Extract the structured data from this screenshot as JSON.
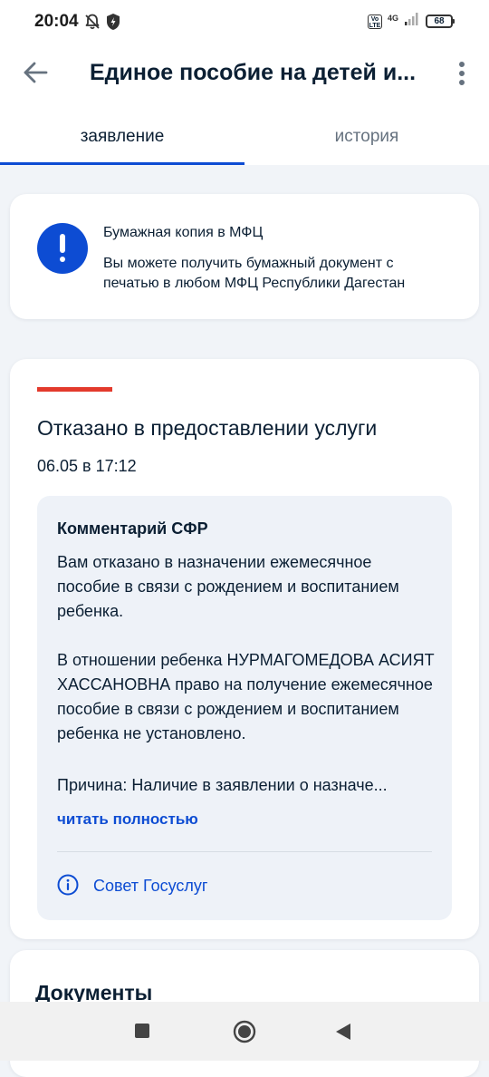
{
  "status_bar": {
    "time": "20:04",
    "volte": "Vo LTE",
    "network": "4G",
    "battery": "68"
  },
  "app_bar": {
    "title": "Единое пособие на детей и..."
  },
  "tabs": [
    {
      "label": "заявление",
      "active": true
    },
    {
      "label": "история",
      "active": false
    }
  ],
  "info_card": {
    "title": "Бумажная копия в МФЦ",
    "text": "Вы можете получить бумажный документ с печатью в любом МФЦ Республики Дагестан"
  },
  "status_card": {
    "title": "Отказано в предоставлении услуги",
    "date": "06.05 в 17:12",
    "status_color": "#e33a2c",
    "comment": {
      "title": "Комментарий СФР",
      "paragraph_1": "Вам отказано в назначении ежемесячное пособие в связи с рождением и воспитанием ребенка.",
      "paragraph_2": "В отношении ребенка НУРМАГОМЕДОВА АСИЯТ ХАССАНОВНА право на получение ежемесячное пособие в связи с рождением и воспитанием ребенка не установлено.",
      "paragraph_3": "Причина: Наличие в заявлении о назначе...",
      "read_more": "читать полностью",
      "advice": "Совет Госуслуг"
    }
  },
  "documents_card": {
    "title": "Документы"
  },
  "colors": {
    "accent": "#0d4cd3",
    "text": "#0b1f33",
    "background": "#f1f4f8"
  }
}
